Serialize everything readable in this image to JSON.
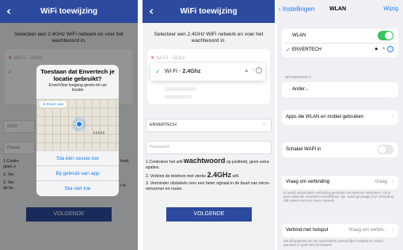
{
  "panel1": {
    "header_title": "WiFi toewijzing",
    "back_icon": "chevron-left-icon",
    "instruction": "Selecteer een 2.4GHz WiFi netwerk en voer het wachtwoord in.",
    "network_5g": "Wi-Fi - 5Ghz",
    "ssid_partial": "SSID",
    "password_partial": "Passw",
    "tips": {
      "tip1_a": "1.Contro",
      "tip1_b": "geen e",
      "tip1_end": "heid,",
      "tip2": "2. Ver",
      "tip3_a": "3. Ver",
      "tip3_b": "de bu",
      "tip3_end": "l in"
    },
    "button": "VOLGENDE",
    "dialog": {
      "title": "Toestaan dat Envertech je locatie gebruikt?",
      "subtitle": "EnverView toegang geven tot uw locatie",
      "precise_label": "Exact: aan",
      "option1": "Sta één sessie toe",
      "option2": "Bij gebruik van app",
      "option3": "Sta niet toe"
    }
  },
  "panel2": {
    "header_title": "WiFi toewijzing",
    "instruction": "Selecteer een 2.4GHz WiFi netwerk en voer het wachtwoord in.",
    "network_5g": "Wi-Fi - 5Ghz",
    "selected_prefix": "Wi-Fi - ",
    "selected_bold": "2.4Ghz",
    "ssid_value": "ENVERTECH",
    "password_placeholder": "Password",
    "tip1_a": "1.Controleer het wifi-",
    "tip1_big": "wachtwoord",
    "tip1_b": " op juistheid, geen extra spaties.",
    "tip2_a": "2. Verbind de telefoon met sterke ",
    "tip2_big": "2.4GHz",
    "tip2_b": " wifi.",
    "tip3": "3. Verminder obstakels voor een beter signaal in de buurt van micro-omvormer en router.",
    "button": "VOLGENDE"
  },
  "panel3": {
    "back_label": "Instellingen",
    "title": "WLAN",
    "edit_label": "Wijzig",
    "wlan_label": "WLAN",
    "wlan_on": true,
    "connected_network": "ENVERTECH",
    "networks_header": "NETWERKEN",
    "other_label": "Ander...",
    "apps_label": "Apps die WLAN en mobiel gebruiken",
    "wapi_label": "Schakel WAPI in",
    "wapi_on": false,
    "ask_label": "Vraag om verbinding",
    "ask_value": "Vraag",
    "ask_note": "Er wordt automatisch verbinding gemaakt met bekende netwerken. Als er geen bekende netwerken beschikbaar zijn, wordt gevraagd of je verbinding wilt maken met een nieuw netwerk.",
    "hotspot_label": "Verbind met hotspot",
    "hotspot_value": "Vraag om verbin...",
    "hotspot_note": "Sta dit apparaat toe om automatisch persoonlijke hotspots te vinden wanneer er geen WLAN-netwerk"
  },
  "colors": {
    "header_blue": "#2c4a9e",
    "ios_blue": "#1a7ef0",
    "ios_green": "#34c759",
    "check_green": "#3cb371",
    "error_red": "#e0443e"
  }
}
